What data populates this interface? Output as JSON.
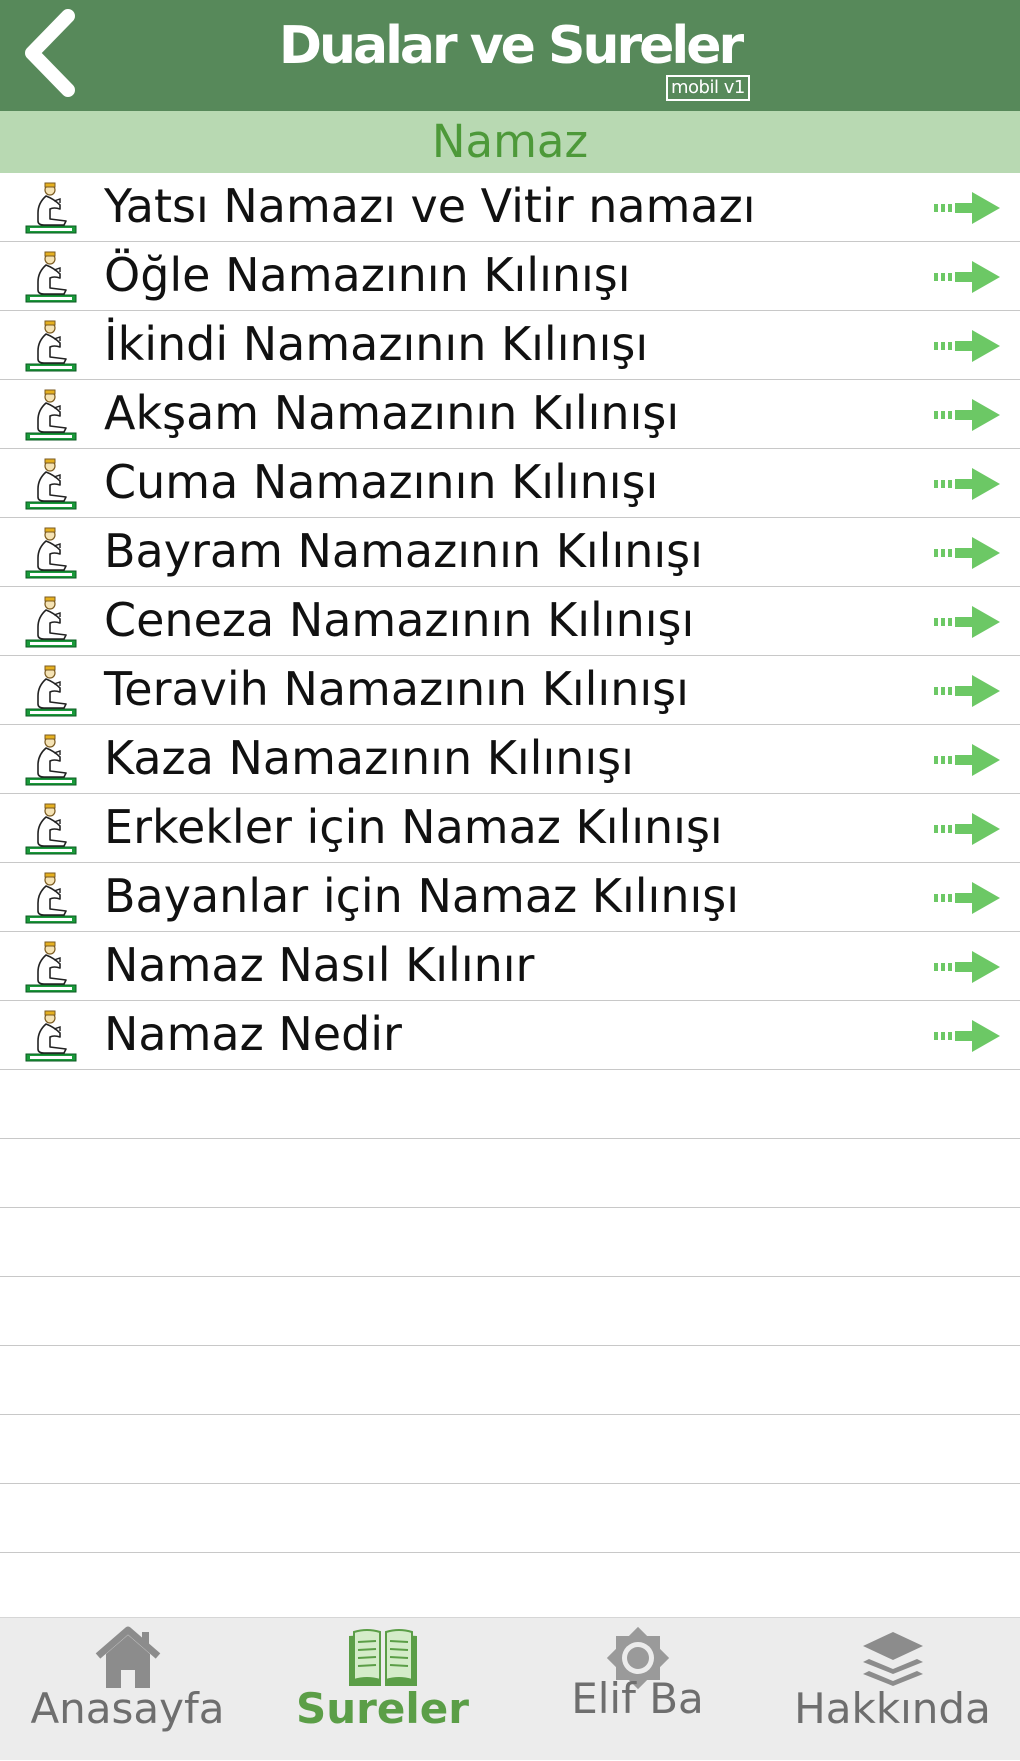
{
  "app": {
    "title": "Dualar ve Sureler",
    "badge": "mobil v1",
    "back_icon": "chevron-left-icon"
  },
  "section": {
    "title": "Namaz"
  },
  "list": {
    "row_icon": "praying-man-icon",
    "arrow_icon": "dotted-arrow-right-icon",
    "items": [
      "Yatsı Namazı ve Vitir namazı",
      "Öğle Namazının Kılınışı",
      "İkindi Namazının Kılınışı",
      "Akşam Namazının Kılınışı",
      "Cuma Namazının Kılınışı",
      "Bayram Namazının Kılınışı",
      "Ceneza Namazının Kılınışı",
      "Teravih Namazının Kılınışı",
      "Kaza Namazının Kılınışı",
      "Erkekler için Namaz Kılınışı",
      "Bayanlar için Namaz Kılınışı",
      "Namaz Nasıl Kılınır",
      "Namaz Nedir"
    ]
  },
  "tabs": [
    {
      "label": "Anasayfa",
      "icon": "home-icon",
      "active": false
    },
    {
      "label": "Sureler",
      "icon": "open-book-icon",
      "active": true
    },
    {
      "label": "Elif Ba",
      "icon": "octagram-star-icon",
      "active": false
    },
    {
      "label": "Hakkında",
      "icon": "layers-icon",
      "active": false
    }
  ],
  "colors": {
    "header_bg": "#57895a",
    "section_bg": "#b8d9b2",
    "section_text": "#4d9939",
    "arrow": "#6cc865",
    "tab_active": "#5b9e47",
    "tab_inactive": "#6e6e6e"
  }
}
